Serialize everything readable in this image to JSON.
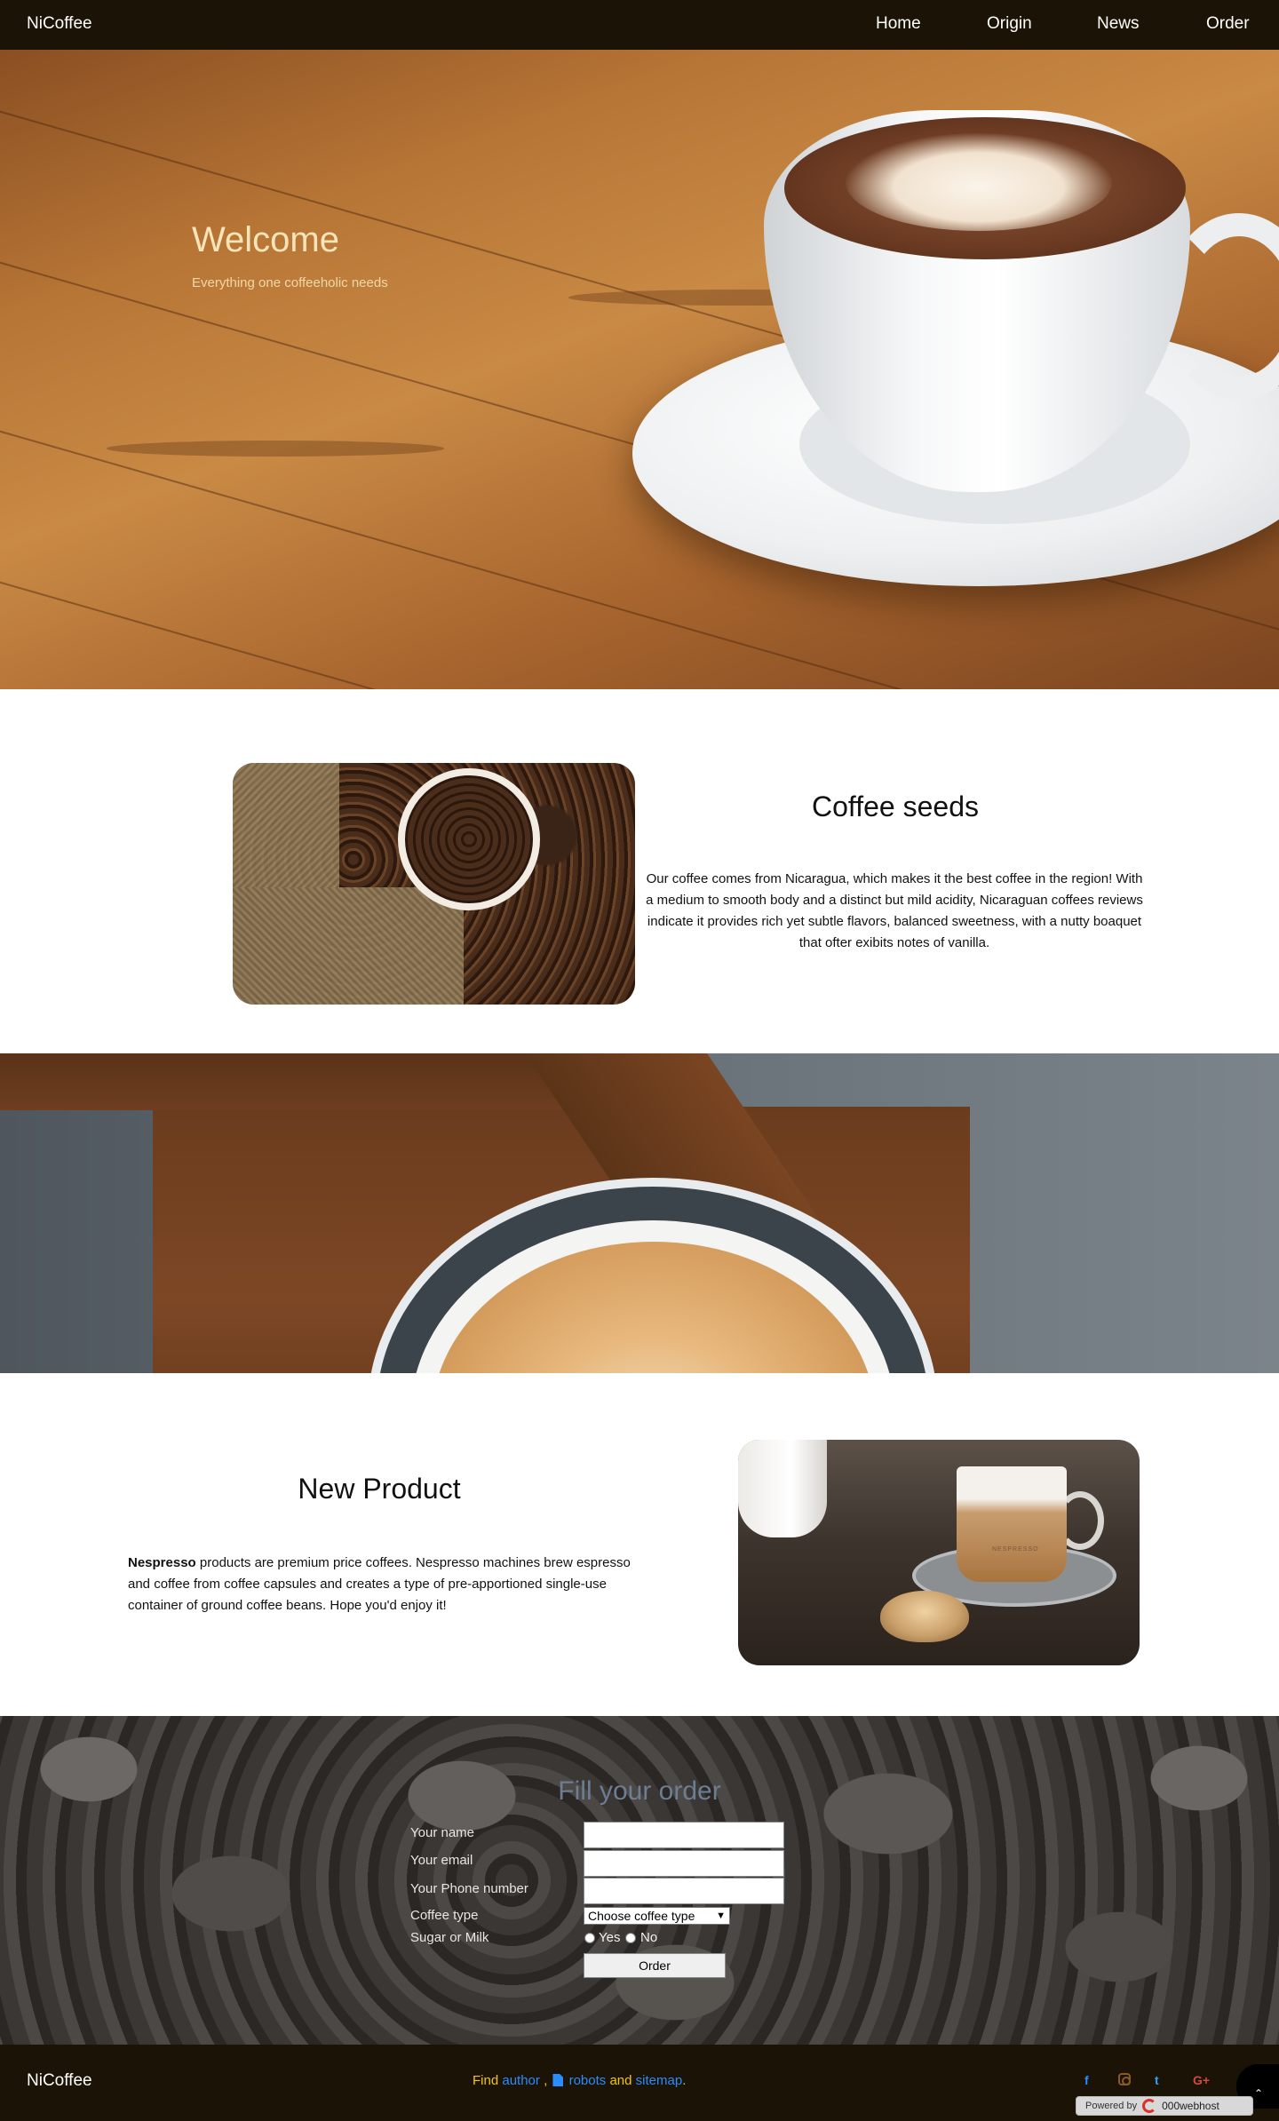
{
  "nav": {
    "brand": "NiCoffee",
    "items": [
      {
        "label": "Home"
      },
      {
        "label": "Origin"
      },
      {
        "label": "News"
      },
      {
        "label": "Order"
      }
    ]
  },
  "hero": {
    "title": "Welcome",
    "subtitle": "Everything one coffeeholic needs"
  },
  "seeds": {
    "title": "Coffee seeds",
    "text": "Our coffee comes from Nicaragua, which makes it the best coffee in the region! With a medium to smooth body and a distinct but mild acidity, Nicaraguan coffees reviews indicate it provides rich yet subtle flavors, balanced sweetness, with a nutty boaquet that ofter exibits notes of vanilla."
  },
  "new_product": {
    "title": "New Product",
    "text_bold": "Nespresso",
    "text": " products are premium price coffees. Nespresso machines brew espresso and coffee from coffee capsules and creates a type of pre-apportioned single-use container of ground coffee beans. Hope you'd enjoy it!",
    "image_brand": "NESPRESSO"
  },
  "order_form": {
    "title": "Fill your order",
    "labels": {
      "name": "Your name",
      "email": "Your email",
      "phone": "Your Phone number",
      "coffee_type": "Coffee type",
      "sugar_milk": "Sugar or Milk"
    },
    "inputs": {
      "name_value": "",
      "email_value": "",
      "phone_value": ""
    },
    "coffee_select": "Choose coffee type",
    "radio_yes": "Yes",
    "radio_no": "No",
    "submit": "Order"
  },
  "footer": {
    "brand": "NiCoffee",
    "find_text": "Find ",
    "author": "author",
    "sep": " , ",
    "robots": "robots",
    "and": " and ",
    "sitemap": "sitemap",
    "period": ".",
    "social": {
      "facebook": "f",
      "twitter": "t",
      "googleplus": "G+"
    },
    "scroll_top": "⌃",
    "powered_by": "Powered by",
    "host": "000webhost"
  },
  "colors": {
    "navbar": "#1b1306",
    "hero_title": "#f7e4b8",
    "order_title": "#6d7d92",
    "footer_find": "#f6c700",
    "footer_link": "#2b8cff"
  }
}
